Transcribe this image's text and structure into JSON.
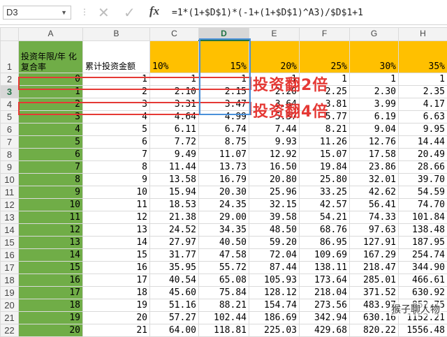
{
  "formula_bar": {
    "name_box": "D3",
    "cancel_icon": "✕",
    "enter_icon": "✓",
    "fx_label": "fx",
    "formula": "=1*(1+$D$1)*(-1+(1+$D$1)^A3)/$D$1+1"
  },
  "columns": [
    "A",
    "B",
    "C",
    "D",
    "E",
    "F",
    "G",
    "H"
  ],
  "header_row": {
    "a1": "投资年限/年 化复合率",
    "b1": "累计投资金额",
    "rates": [
      "10%",
      "15%",
      "20%",
      "25%",
      "30%",
      "35%"
    ]
  },
  "rows": [
    {
      "n": "2",
      "a": "0",
      "b": "1",
      "v": [
        "1",
        "1",
        "1",
        "1",
        "1",
        "1"
      ]
    },
    {
      "n": "3",
      "a": "1",
      "b": "2",
      "v": [
        "2.10",
        "2.15",
        "2.20",
        "2.25",
        "2.30",
        "2.35"
      ]
    },
    {
      "n": "4",
      "a": "2",
      "b": "3",
      "v": [
        "3.31",
        "3.47",
        "3.64",
        "3.81",
        "3.99",
        "4.17"
      ]
    },
    {
      "n": "5",
      "a": "3",
      "b": "4",
      "v": [
        "4.64",
        "4.99",
        "5.37",
        "5.77",
        "6.19",
        "6.63"
      ]
    },
    {
      "n": "6",
      "a": "4",
      "b": "5",
      "v": [
        "6.11",
        "6.74",
        "7.44",
        "8.21",
        "9.04",
        "9.95"
      ]
    },
    {
      "n": "7",
      "a": "5",
      "b": "6",
      "v": [
        "7.72",
        "8.75",
        "9.93",
        "11.26",
        "12.76",
        "14.44"
      ]
    },
    {
      "n": "8",
      "a": "6",
      "b": "7",
      "v": [
        "9.49",
        "11.07",
        "12.92",
        "15.07",
        "17.58",
        "20.49"
      ]
    },
    {
      "n": "9",
      "a": "7",
      "b": "8",
      "v": [
        "11.44",
        "13.73",
        "16.50",
        "19.84",
        "23.86",
        "28.66"
      ]
    },
    {
      "n": "10",
      "a": "8",
      "b": "9",
      "v": [
        "13.58",
        "16.79",
        "20.80",
        "25.80",
        "32.01",
        "39.70"
      ]
    },
    {
      "n": "11",
      "a": "9",
      "b": "10",
      "v": [
        "15.94",
        "20.30",
        "25.96",
        "33.25",
        "42.62",
        "54.59"
      ]
    },
    {
      "n": "12",
      "a": "10",
      "b": "11",
      "v": [
        "18.53",
        "24.35",
        "32.15",
        "42.57",
        "56.41",
        "74.70"
      ]
    },
    {
      "n": "13",
      "a": "11",
      "b": "12",
      "v": [
        "21.38",
        "29.00",
        "39.58",
        "54.21",
        "74.33",
        "101.84"
      ]
    },
    {
      "n": "14",
      "a": "12",
      "b": "13",
      "v": [
        "24.52",
        "34.35",
        "48.50",
        "68.76",
        "97.63",
        "138.48"
      ]
    },
    {
      "n": "15",
      "a": "13",
      "b": "14",
      "v": [
        "27.97",
        "40.50",
        "59.20",
        "86.95",
        "127.91",
        "187.95"
      ]
    },
    {
      "n": "16",
      "a": "14",
      "b": "15",
      "v": [
        "31.77",
        "47.58",
        "72.04",
        "109.69",
        "167.29",
        "254.74"
      ]
    },
    {
      "n": "17",
      "a": "15",
      "b": "16",
      "v": [
        "35.95",
        "55.72",
        "87.44",
        "138.11",
        "218.47",
        "344.90"
      ]
    },
    {
      "n": "18",
      "a": "16",
      "b": "17",
      "v": [
        "40.54",
        "65.08",
        "105.93",
        "173.64",
        "285.01",
        "466.61"
      ]
    },
    {
      "n": "19",
      "a": "17",
      "b": "18",
      "v": [
        "45.60",
        "75.84",
        "128.12",
        "218.04",
        "371.52",
        "630.92"
      ]
    },
    {
      "n": "20",
      "a": "18",
      "b": "19",
      "v": [
        "51.16",
        "88.21",
        "154.74",
        "273.56",
        "483.97",
        "852.75"
      ]
    },
    {
      "n": "21",
      "a": "19",
      "b": "20",
      "v": [
        "57.27",
        "102.44",
        "186.69",
        "342.94",
        "630.16",
        "1152.21"
      ]
    },
    {
      "n": "22",
      "a": "20",
      "b": "21",
      "v": [
        "64.00",
        "118.81",
        "225.03",
        "429.68",
        "820.22",
        "1556.48"
      ]
    }
  ],
  "annotations": {
    "double": "投资翻2倍",
    "quadruple": "投资翻4倍",
    "watermark": "猴子聊人物"
  },
  "colors": {
    "green_fill": "#70ad47",
    "orange_fill": "#ffc000",
    "red_box": "#e53935",
    "blue_box": "#4a90d9"
  }
}
